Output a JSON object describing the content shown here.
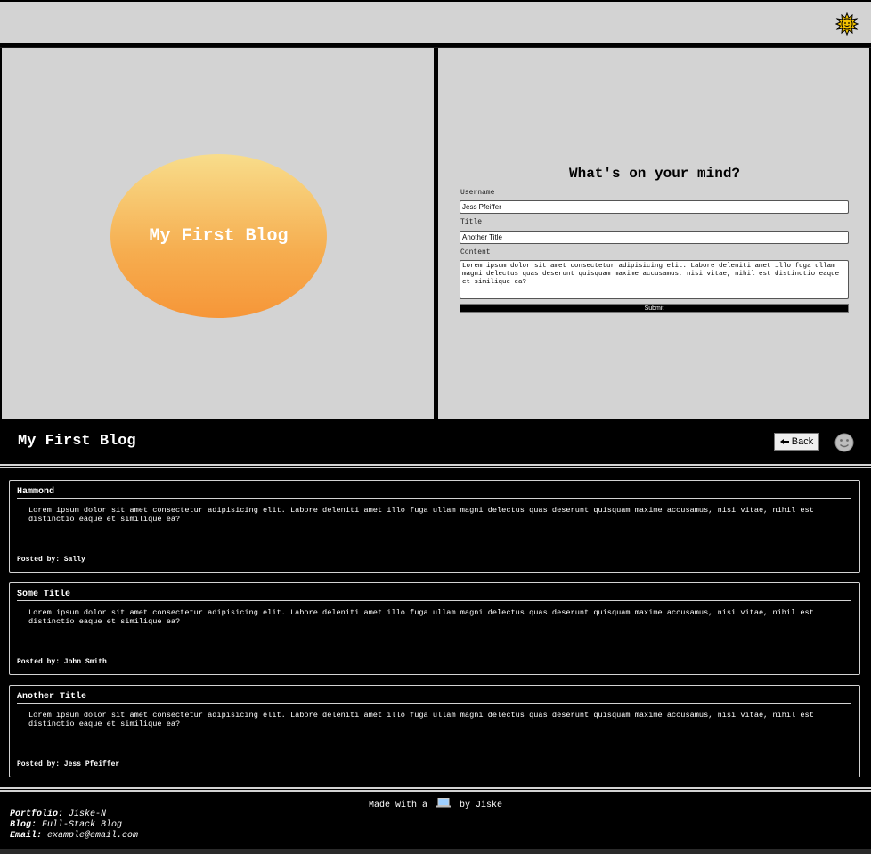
{
  "theme_toggle": {
    "icon": "sun-icon"
  },
  "hero": {
    "title": "My First Blog"
  },
  "form": {
    "heading": "What's on your mind?",
    "username_label": "Username",
    "username_value": "Jess Pfeiffer",
    "title_label": "Title",
    "title_value": "Another Title",
    "content_label": "Content",
    "content_value": "Lorem ipsum dolor sit amet consectetur adipisicing elit. Labore deleniti amet illo fuga ullam magni delectus quas deserunt quisquam maxime accusamus, nisi vitae, nihil est distinctio eaque et similique ea?",
    "submit_label": "Submit"
  },
  "blog_header": {
    "title": "My First Blog",
    "back_label": "Back",
    "back_icon": "arrow-left-icon",
    "mode_icon": "moon-icon"
  },
  "posts": [
    {
      "title": "Hammond",
      "body": "Lorem ipsum dolor sit amet consectetur adipisicing elit. Labore deleniti amet illo fuga ullam magni delectus quas deserunt quisquam maxime accusamus, nisi vitae, nihil est distinctio eaque et similique ea?",
      "posted_by": "Posted by: Sally"
    },
    {
      "title": "Some Title",
      "body": "Lorem ipsum dolor sit amet consectetur adipisicing elit. Labore deleniti amet illo fuga ullam magni delectus quas deserunt quisquam maxime accusamus, nisi vitae, nihil est distinctio eaque et similique ea?",
      "posted_by": "Posted by: John Smith"
    },
    {
      "title": "Another Title",
      "body": "Lorem ipsum dolor sit amet consectetur adipisicing elit. Labore deleniti amet illo fuga ullam magni delectus quas deserunt quisquam maxime accusamus, nisi vitae, nihil est distinctio eaque et similique ea?",
      "posted_by": "Posted by: Jess Pfeiffer"
    }
  ],
  "footer": {
    "made_prefix": "Made with a",
    "made_icon": "laptop-icon",
    "made_suffix": "by Jiske",
    "portfolio_label": "Portfolio:",
    "portfolio_value": "Jiske-N",
    "blog_label": "Blog:",
    "blog_value": "Full-Stack Blog",
    "email_label": "Email:",
    "email_value": "example@email.com"
  },
  "colors": {
    "light_bg": "#d3d3d3",
    "dark_bg": "#000000",
    "oval_top": "#f8dd8b",
    "oval_bottom": "#f69638"
  }
}
